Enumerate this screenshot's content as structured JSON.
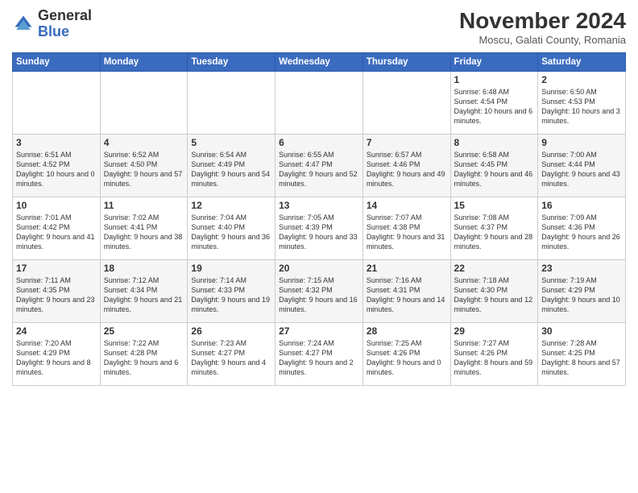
{
  "logo": {
    "general": "General",
    "blue": "Blue"
  },
  "title": "November 2024",
  "subtitle": "Moscu, Galati County, Romania",
  "weekdays": [
    "Sunday",
    "Monday",
    "Tuesday",
    "Wednesday",
    "Thursday",
    "Friday",
    "Saturday"
  ],
  "weeks": [
    [
      {
        "day": "",
        "info": ""
      },
      {
        "day": "",
        "info": ""
      },
      {
        "day": "",
        "info": ""
      },
      {
        "day": "",
        "info": ""
      },
      {
        "day": "",
        "info": ""
      },
      {
        "day": "1",
        "info": "Sunrise: 6:48 AM\nSunset: 4:54 PM\nDaylight: 10 hours and 6 minutes."
      },
      {
        "day": "2",
        "info": "Sunrise: 6:50 AM\nSunset: 4:53 PM\nDaylight: 10 hours and 3 minutes."
      }
    ],
    [
      {
        "day": "3",
        "info": "Sunrise: 6:51 AM\nSunset: 4:52 PM\nDaylight: 10 hours and 0 minutes."
      },
      {
        "day": "4",
        "info": "Sunrise: 6:52 AM\nSunset: 4:50 PM\nDaylight: 9 hours and 57 minutes."
      },
      {
        "day": "5",
        "info": "Sunrise: 6:54 AM\nSunset: 4:49 PM\nDaylight: 9 hours and 54 minutes."
      },
      {
        "day": "6",
        "info": "Sunrise: 6:55 AM\nSunset: 4:47 PM\nDaylight: 9 hours and 52 minutes."
      },
      {
        "day": "7",
        "info": "Sunrise: 6:57 AM\nSunset: 4:46 PM\nDaylight: 9 hours and 49 minutes."
      },
      {
        "day": "8",
        "info": "Sunrise: 6:58 AM\nSunset: 4:45 PM\nDaylight: 9 hours and 46 minutes."
      },
      {
        "day": "9",
        "info": "Sunrise: 7:00 AM\nSunset: 4:44 PM\nDaylight: 9 hours and 43 minutes."
      }
    ],
    [
      {
        "day": "10",
        "info": "Sunrise: 7:01 AM\nSunset: 4:42 PM\nDaylight: 9 hours and 41 minutes."
      },
      {
        "day": "11",
        "info": "Sunrise: 7:02 AM\nSunset: 4:41 PM\nDaylight: 9 hours and 38 minutes."
      },
      {
        "day": "12",
        "info": "Sunrise: 7:04 AM\nSunset: 4:40 PM\nDaylight: 9 hours and 36 minutes."
      },
      {
        "day": "13",
        "info": "Sunrise: 7:05 AM\nSunset: 4:39 PM\nDaylight: 9 hours and 33 minutes."
      },
      {
        "day": "14",
        "info": "Sunrise: 7:07 AM\nSunset: 4:38 PM\nDaylight: 9 hours and 31 minutes."
      },
      {
        "day": "15",
        "info": "Sunrise: 7:08 AM\nSunset: 4:37 PM\nDaylight: 9 hours and 28 minutes."
      },
      {
        "day": "16",
        "info": "Sunrise: 7:09 AM\nSunset: 4:36 PM\nDaylight: 9 hours and 26 minutes."
      }
    ],
    [
      {
        "day": "17",
        "info": "Sunrise: 7:11 AM\nSunset: 4:35 PM\nDaylight: 9 hours and 23 minutes."
      },
      {
        "day": "18",
        "info": "Sunrise: 7:12 AM\nSunset: 4:34 PM\nDaylight: 9 hours and 21 minutes."
      },
      {
        "day": "19",
        "info": "Sunrise: 7:14 AM\nSunset: 4:33 PM\nDaylight: 9 hours and 19 minutes."
      },
      {
        "day": "20",
        "info": "Sunrise: 7:15 AM\nSunset: 4:32 PM\nDaylight: 9 hours and 16 minutes."
      },
      {
        "day": "21",
        "info": "Sunrise: 7:16 AM\nSunset: 4:31 PM\nDaylight: 9 hours and 14 minutes."
      },
      {
        "day": "22",
        "info": "Sunrise: 7:18 AM\nSunset: 4:30 PM\nDaylight: 9 hours and 12 minutes."
      },
      {
        "day": "23",
        "info": "Sunrise: 7:19 AM\nSunset: 4:29 PM\nDaylight: 9 hours and 10 minutes."
      }
    ],
    [
      {
        "day": "24",
        "info": "Sunrise: 7:20 AM\nSunset: 4:29 PM\nDaylight: 9 hours and 8 minutes."
      },
      {
        "day": "25",
        "info": "Sunrise: 7:22 AM\nSunset: 4:28 PM\nDaylight: 9 hours and 6 minutes."
      },
      {
        "day": "26",
        "info": "Sunrise: 7:23 AM\nSunset: 4:27 PM\nDaylight: 9 hours and 4 minutes."
      },
      {
        "day": "27",
        "info": "Sunrise: 7:24 AM\nSunset: 4:27 PM\nDaylight: 9 hours and 2 minutes."
      },
      {
        "day": "28",
        "info": "Sunrise: 7:25 AM\nSunset: 4:26 PM\nDaylight: 9 hours and 0 minutes."
      },
      {
        "day": "29",
        "info": "Sunrise: 7:27 AM\nSunset: 4:26 PM\nDaylight: 8 hours and 59 minutes."
      },
      {
        "day": "30",
        "info": "Sunrise: 7:28 AM\nSunset: 4:25 PM\nDaylight: 8 hours and 57 minutes."
      }
    ]
  ]
}
